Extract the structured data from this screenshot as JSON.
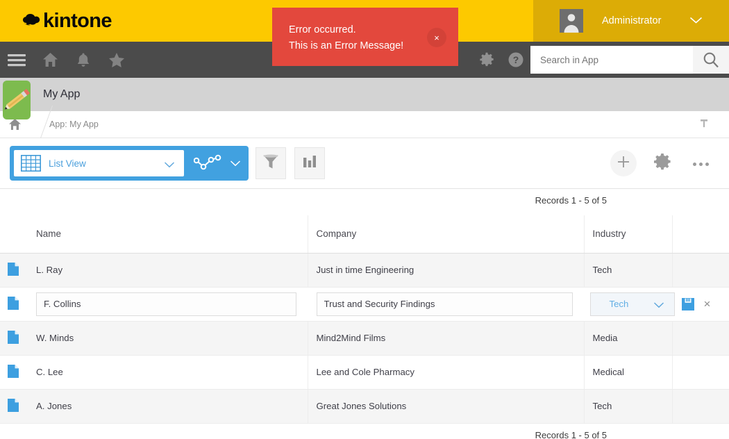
{
  "brand": {
    "logo_text": "kintone",
    "header_color": "#fdc900",
    "user_bar_color": "#dcac06",
    "accent_blue": "#41a1e0",
    "error_red": "#e3483d",
    "app_icon_green": "#7dbb4e"
  },
  "header": {
    "user_name": "Administrator",
    "avatar_icon": "user-silhouette-icon",
    "user_chevron_icon": "chevron-down-icon"
  },
  "nav": {
    "items": [
      {
        "name": "menu-hamburger",
        "icon": "hamburger-icon"
      },
      {
        "name": "home",
        "icon": "home-icon"
      },
      {
        "name": "notifications",
        "icon": "bell-icon"
      },
      {
        "name": "favorites",
        "icon": "star-icon"
      }
    ],
    "gear_icon": "gear-icon",
    "help_icon": "question-circle-icon",
    "search": {
      "placeholder": "Search in App",
      "value": "",
      "button_icon": "search-icon"
    }
  },
  "error_toast": {
    "line1": "Error occurred.",
    "line2": "This is an Error Message!",
    "close_label": "×",
    "close_icon": "close-icon"
  },
  "app_bar": {
    "title": "My App",
    "icon": "pencil-app-icon"
  },
  "breadcrumb": {
    "home_icon": "home-icon",
    "path": "App: My App",
    "pin_icon": "pushpin-icon"
  },
  "toolbar": {
    "view_label": "List View",
    "view_grid_icon": "table-grid-icon",
    "view_chevron_icon": "chevron-down-icon",
    "graph_icon": "line-graph-icon",
    "graph_chevron_icon": "chevron-down-icon",
    "filter_icon": "funnel-filter-icon",
    "chart_icon": "bar-chart-icon",
    "add_icon": "plus-icon",
    "settings_icon": "gear-icon",
    "more_icon": "ellipsis-icon"
  },
  "records_info": {
    "top": "Records 1 - 5 of 5",
    "bottom": "Records 1 - 5 of 5"
  },
  "table": {
    "columns": [
      "",
      "Name",
      "Company",
      "Industry",
      ""
    ],
    "row_icon": "document-page-icon",
    "rows": [
      {
        "name": "L. Ray",
        "company": "Just in time Engineering",
        "industry": "Tech",
        "editing": false,
        "shade": true
      },
      {
        "name": "F. Collins",
        "company": "Trust and Security Findings",
        "industry": "Tech",
        "editing": true,
        "shade": false
      },
      {
        "name": "W. Minds",
        "company": "Mind2Mind Films",
        "industry": "Media",
        "editing": false,
        "shade": true
      },
      {
        "name": "C. Lee",
        "company": "Lee and Cole Pharmacy",
        "industry": "Medical",
        "editing": false,
        "shade": false
      },
      {
        "name": "A. Jones",
        "company": "Great Jones Solutions",
        "industry": "Tech",
        "editing": false,
        "shade": true
      }
    ],
    "edit_row_actions": {
      "save_icon": "floppy-disk-save-icon",
      "cancel_icon": "close-x-icon",
      "cancel_label": "×"
    },
    "industry_select_chevron": "chevron-down-icon"
  }
}
